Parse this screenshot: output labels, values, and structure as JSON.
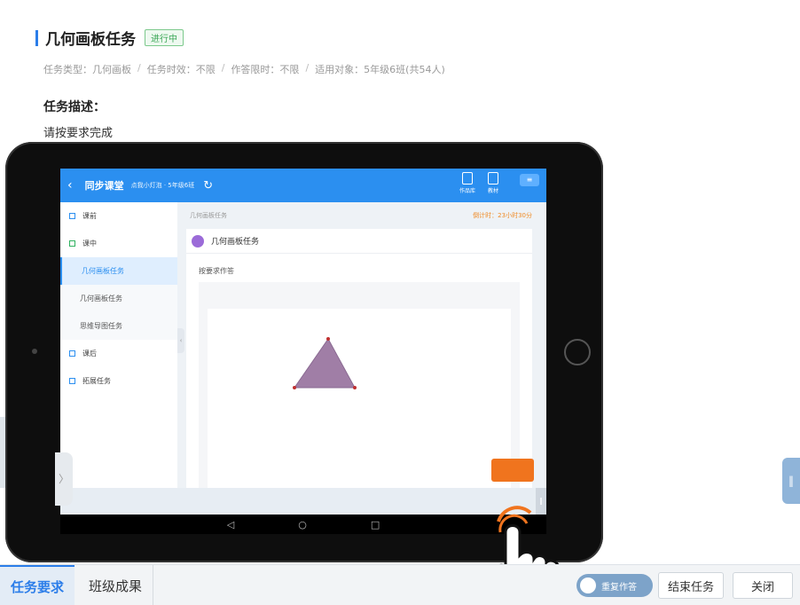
{
  "header": {
    "title": "几何画板任务",
    "status": "进行中",
    "meta": {
      "type": "任务类型：几何画板",
      "validity": "任务时效：不限",
      "time_limit": "作答限时：不限",
      "target": "适用对象：5年级6班(共54人)"
    },
    "desc_label": "任务描述：",
    "desc_text": "请按要求完成"
  },
  "tablet": {
    "app_title": "同步课堂",
    "app_sub": "点我小灯泡 · 5年级6班",
    "tools": [
      "作品库",
      "教材"
    ],
    "sidebar": [
      {
        "label": "课前",
        "kind": "section"
      },
      {
        "label": "课中",
        "kind": "section-green"
      },
      {
        "label": "几何画板任务",
        "kind": "active"
      },
      {
        "label": "几何画板任务",
        "kind": "sub"
      },
      {
        "label": "思维导图任务",
        "kind": "sub"
      },
      {
        "label": "课后",
        "kind": "section"
      },
      {
        "label": "拓展任务",
        "kind": "section"
      }
    ],
    "breadcrumb": "几何画板任务",
    "timer": "倒计时：23小时30分",
    "task_title": "几何画板任务",
    "task_req": "按要求作答"
  },
  "bottom": {
    "tab_requirements": "任务要求",
    "tab_results": "班级成果",
    "toggle_label": "重复作答",
    "end_button": "结束任务",
    "close_button": "关闭"
  },
  "colors": {
    "accent": "#2b7de9",
    "app_blue": "#2b8ff0",
    "status_green": "#3aa655",
    "submit_orange": "#f0741e",
    "triangle": "#a07ea6"
  }
}
